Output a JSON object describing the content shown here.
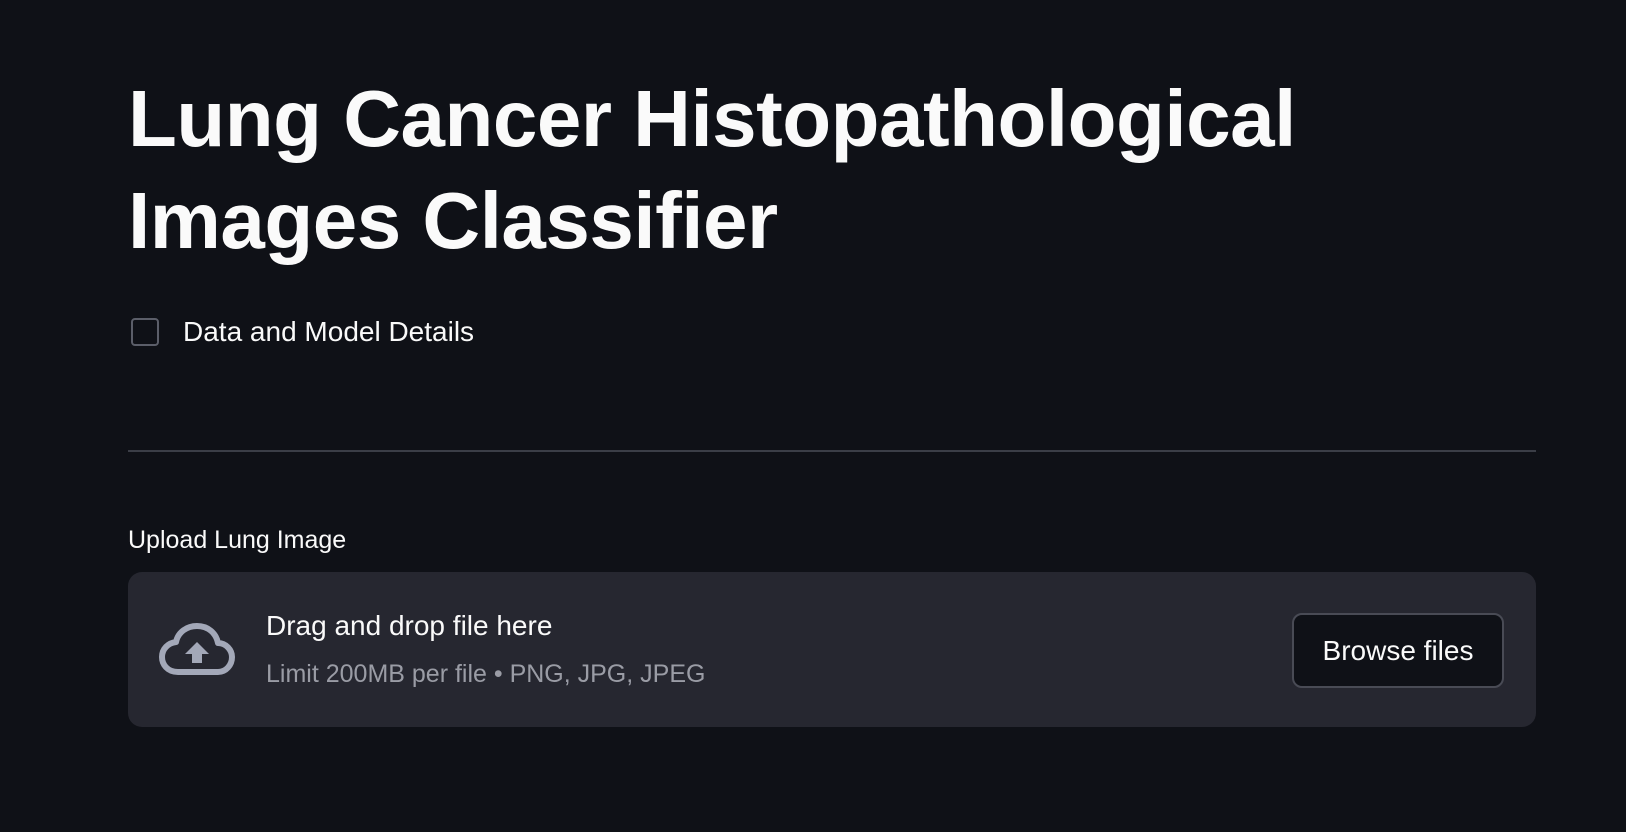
{
  "header": {
    "title": "Lung Cancer Histopathological Images Classifier"
  },
  "options": {
    "details_checkbox": {
      "label": "Data and Model Details",
      "checked": false
    }
  },
  "uploader": {
    "label": "Upload Lung Image",
    "drop_text": "Drag and drop file here",
    "limit_text": "Limit 200MB per file • PNG, JPG, JPEG",
    "browse_label": "Browse files",
    "icon": "cloud-upload-icon"
  },
  "colors": {
    "background": "#0f1117",
    "dropzone": "#262730",
    "text": "#fafafa",
    "muted_text": "#9a9ca5",
    "border": "#494b55"
  }
}
